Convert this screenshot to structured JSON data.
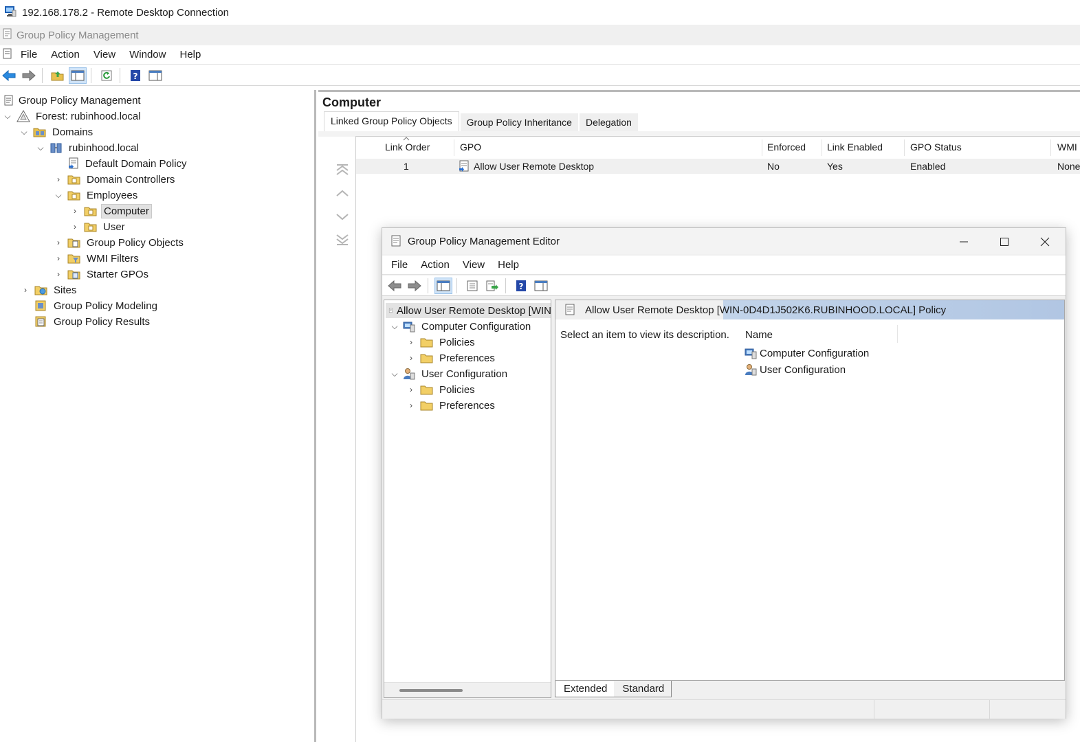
{
  "rdp": {
    "title": "192.168.178.2 - Remote Desktop Connection"
  },
  "app": {
    "title": "Group Policy Management",
    "menu": [
      "File",
      "Action",
      "View",
      "Window",
      "Help"
    ]
  },
  "tree": {
    "root": "Group Policy Management",
    "forest": "Forest: rubinhood.local",
    "domains": "Domains",
    "domain": "rubinhood.local",
    "default_policy": "Default Domain Policy",
    "domain_controllers": "Domain Controllers",
    "employees": "Employees",
    "computer": "Computer",
    "user": "User",
    "gpo_objects": "Group Policy Objects",
    "wmi_filters": "WMI Filters",
    "starter_gpos": "Starter GPOs",
    "sites": "Sites",
    "modeling": "Group Policy Modeling",
    "results": "Group Policy Results"
  },
  "details": {
    "title": "Computer",
    "tabs": [
      "Linked Group Policy Objects",
      "Group Policy Inheritance",
      "Delegation"
    ],
    "columns": [
      "Link Order",
      "GPO",
      "Enforced",
      "Link Enabled",
      "GPO Status",
      "WMI"
    ],
    "row": {
      "order": "1",
      "gpo": "Allow User Remote Desktop",
      "enforced": "No",
      "link_enabled": "Yes",
      "status": "Enabled",
      "wmi": "None"
    }
  },
  "editor": {
    "title": "Group Policy Management Editor",
    "menu": [
      "File",
      "Action",
      "View",
      "Help"
    ],
    "tree": {
      "root": "Allow User Remote Desktop [WIN",
      "computer_config": "Computer Configuration",
      "cc_policies": "Policies",
      "cc_preferences": "Preferences",
      "user_config": "User Configuration",
      "uc_policies": "Policies",
      "uc_preferences": "Preferences"
    },
    "header": "Allow User Remote Desktop [WIN-0D4D1J502K6.RUBINHOOD.LOCAL] Policy",
    "description": "Select an item to view its description.",
    "name_col": "Name",
    "items": [
      "Computer Configuration",
      "User Configuration"
    ],
    "tabs": [
      "Extended",
      "Standard"
    ]
  }
}
